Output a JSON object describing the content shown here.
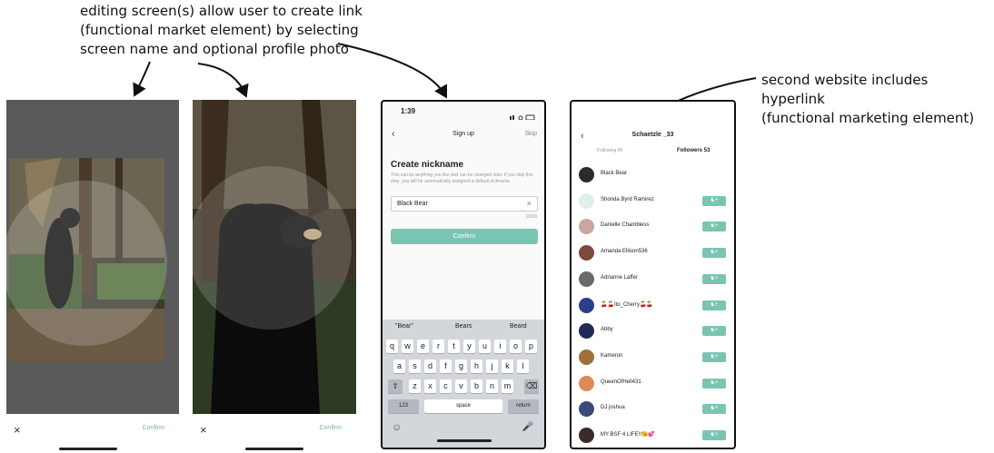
{
  "annotations": {
    "left_lines": [
      "editing screen(s) allow user to create link",
      "(functional market element) by selecting",
      "screen name and optional profile photo"
    ],
    "right_lines": [
      "second website includes hyperlink",
      "(functional marketing element)"
    ]
  },
  "screen1": {
    "close": "×",
    "confirm": "Confirm"
  },
  "screen2": {
    "close": "×",
    "confirm": "Confirm"
  },
  "signup": {
    "time": "1:39",
    "title": "Sign up",
    "skip": "Skip",
    "heading": "Create nickname",
    "description": "This can be anything you like and can be changed later. If you skip this step, you will be automatically assigned a default nickname.",
    "input_value": "Black Bear",
    "counter": "10/20",
    "confirm": "Confirm",
    "suggestions": [
      "\"Bear\"",
      "Bears",
      "Beard"
    ],
    "keys_row1": [
      "q",
      "w",
      "e",
      "r",
      "t",
      "y",
      "u",
      "i",
      "o",
      "p"
    ],
    "keys_row2": [
      "a",
      "s",
      "d",
      "f",
      "g",
      "h",
      "j",
      "k",
      "l"
    ],
    "keys_row3": [
      "z",
      "x",
      "c",
      "v",
      "b",
      "n",
      "m"
    ],
    "key_123": "123",
    "key_space": "space",
    "key_return": "return"
  },
  "profile": {
    "title": "Schaetzle _33",
    "following": "Following 49",
    "followers": "Followers 53",
    "follow_icon": "person-plus-icon",
    "rows": [
      {
        "name": "Black Bear",
        "color": "#2b2b2b",
        "follow": false
      },
      {
        "name": "Shonda Byrd Ramirez",
        "color": "#dff0ea",
        "follow": true
      },
      {
        "name": "Danielle Chambless",
        "color": "#c9a7a0",
        "follow": true
      },
      {
        "name": "Amanda Ellison536",
        "color": "#7a4a3a",
        "follow": true
      },
      {
        "name": "Adrianne Laffer",
        "color": "#6a6a6a",
        "follow": true
      },
      {
        "name": "🍒🍒Ito_Cherry🍒🍒",
        "color": "#2c3e88",
        "follow": true
      },
      {
        "name": "Abby",
        "color": "#1f2a55",
        "follow": true
      },
      {
        "name": "Kameron",
        "color": "#a0703a",
        "follow": true
      },
      {
        "name": "QueenOfHell431",
        "color": "#e08a5a",
        "follow": true
      },
      {
        "name": "DJ joshua",
        "color": "#3b4a7a",
        "follow": true
      },
      {
        "name": "MY BSF 4 LIFE!!😘💕",
        "color": "#3a2a2a",
        "follow": true
      }
    ]
  }
}
